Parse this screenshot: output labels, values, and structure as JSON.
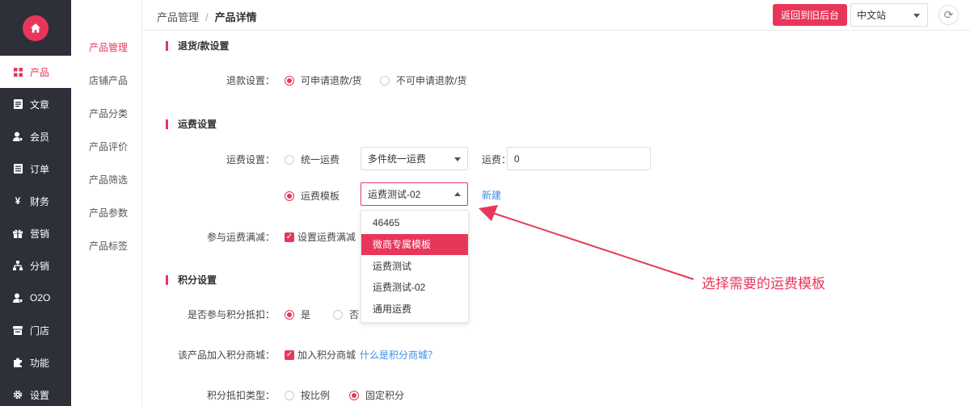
{
  "sidebar": {
    "items": [
      {
        "label": "产品",
        "icon": "grid-icon",
        "active": true
      },
      {
        "label": "文章",
        "icon": "document-icon"
      },
      {
        "label": "会员",
        "icon": "user-icon"
      },
      {
        "label": "订单",
        "icon": "list-icon"
      },
      {
        "label": "财务",
        "icon": "yen-icon"
      },
      {
        "label": "营销",
        "icon": "gift-icon"
      },
      {
        "label": "分销",
        "icon": "network-icon"
      },
      {
        "label": "O2O",
        "icon": "user-icon"
      },
      {
        "label": "门店",
        "icon": "store-icon"
      },
      {
        "label": "功能",
        "icon": "puzzle-icon"
      },
      {
        "label": "设置",
        "icon": "gear-icon"
      }
    ]
  },
  "submenu": {
    "items": [
      "产品管理",
      "店铺产品",
      "产品分类",
      "产品评价",
      "产品筛选",
      "产品参数",
      "产品标签"
    ]
  },
  "header": {
    "breadcrumb_parent": "产品管理",
    "breadcrumb_sep": "/",
    "breadcrumb_current": "产品详情",
    "back_button": "返回到旧后台",
    "site_select": "中文站"
  },
  "refund": {
    "title": "退货/款设置",
    "label": "退款设置：",
    "option_yes": "可申请退款/货",
    "option_no": "不可申请退款/货"
  },
  "shipping": {
    "title": "运费设置",
    "label": "运费设置：",
    "unified_label": "统一运费",
    "unified_select": "多件统一运费",
    "fee_label": "运费：",
    "fee_value": "0",
    "template_label": "运费模板",
    "template_select": "运费测试-02",
    "new_link": "新建",
    "reduction_label": "参与运费满减：",
    "reduction_check": "设置运费满减",
    "dropdown_options": [
      "46465",
      "微商专属模板",
      "运费测试",
      "运费测试-02",
      "通用运费"
    ],
    "dropdown_highlighted": 1
  },
  "points": {
    "title": "积分设置",
    "deduct_label": "是否参与积分抵扣：",
    "deduct_yes": "是",
    "deduct_no": "否",
    "mall_label": "该产品加入积分商城：",
    "mall_check": "加入积分商城",
    "mall_link": "什么是积分商城？",
    "type_label": "积分抵扣类型：",
    "type_ratio": "按比例",
    "type_fixed": "固定积分"
  },
  "annotation": {
    "text": "选择需要的运费模板"
  },
  "colors": {
    "accent": "#e8365b",
    "sidebar_bg": "#2d3039",
    "link": "#3a8ee6"
  }
}
